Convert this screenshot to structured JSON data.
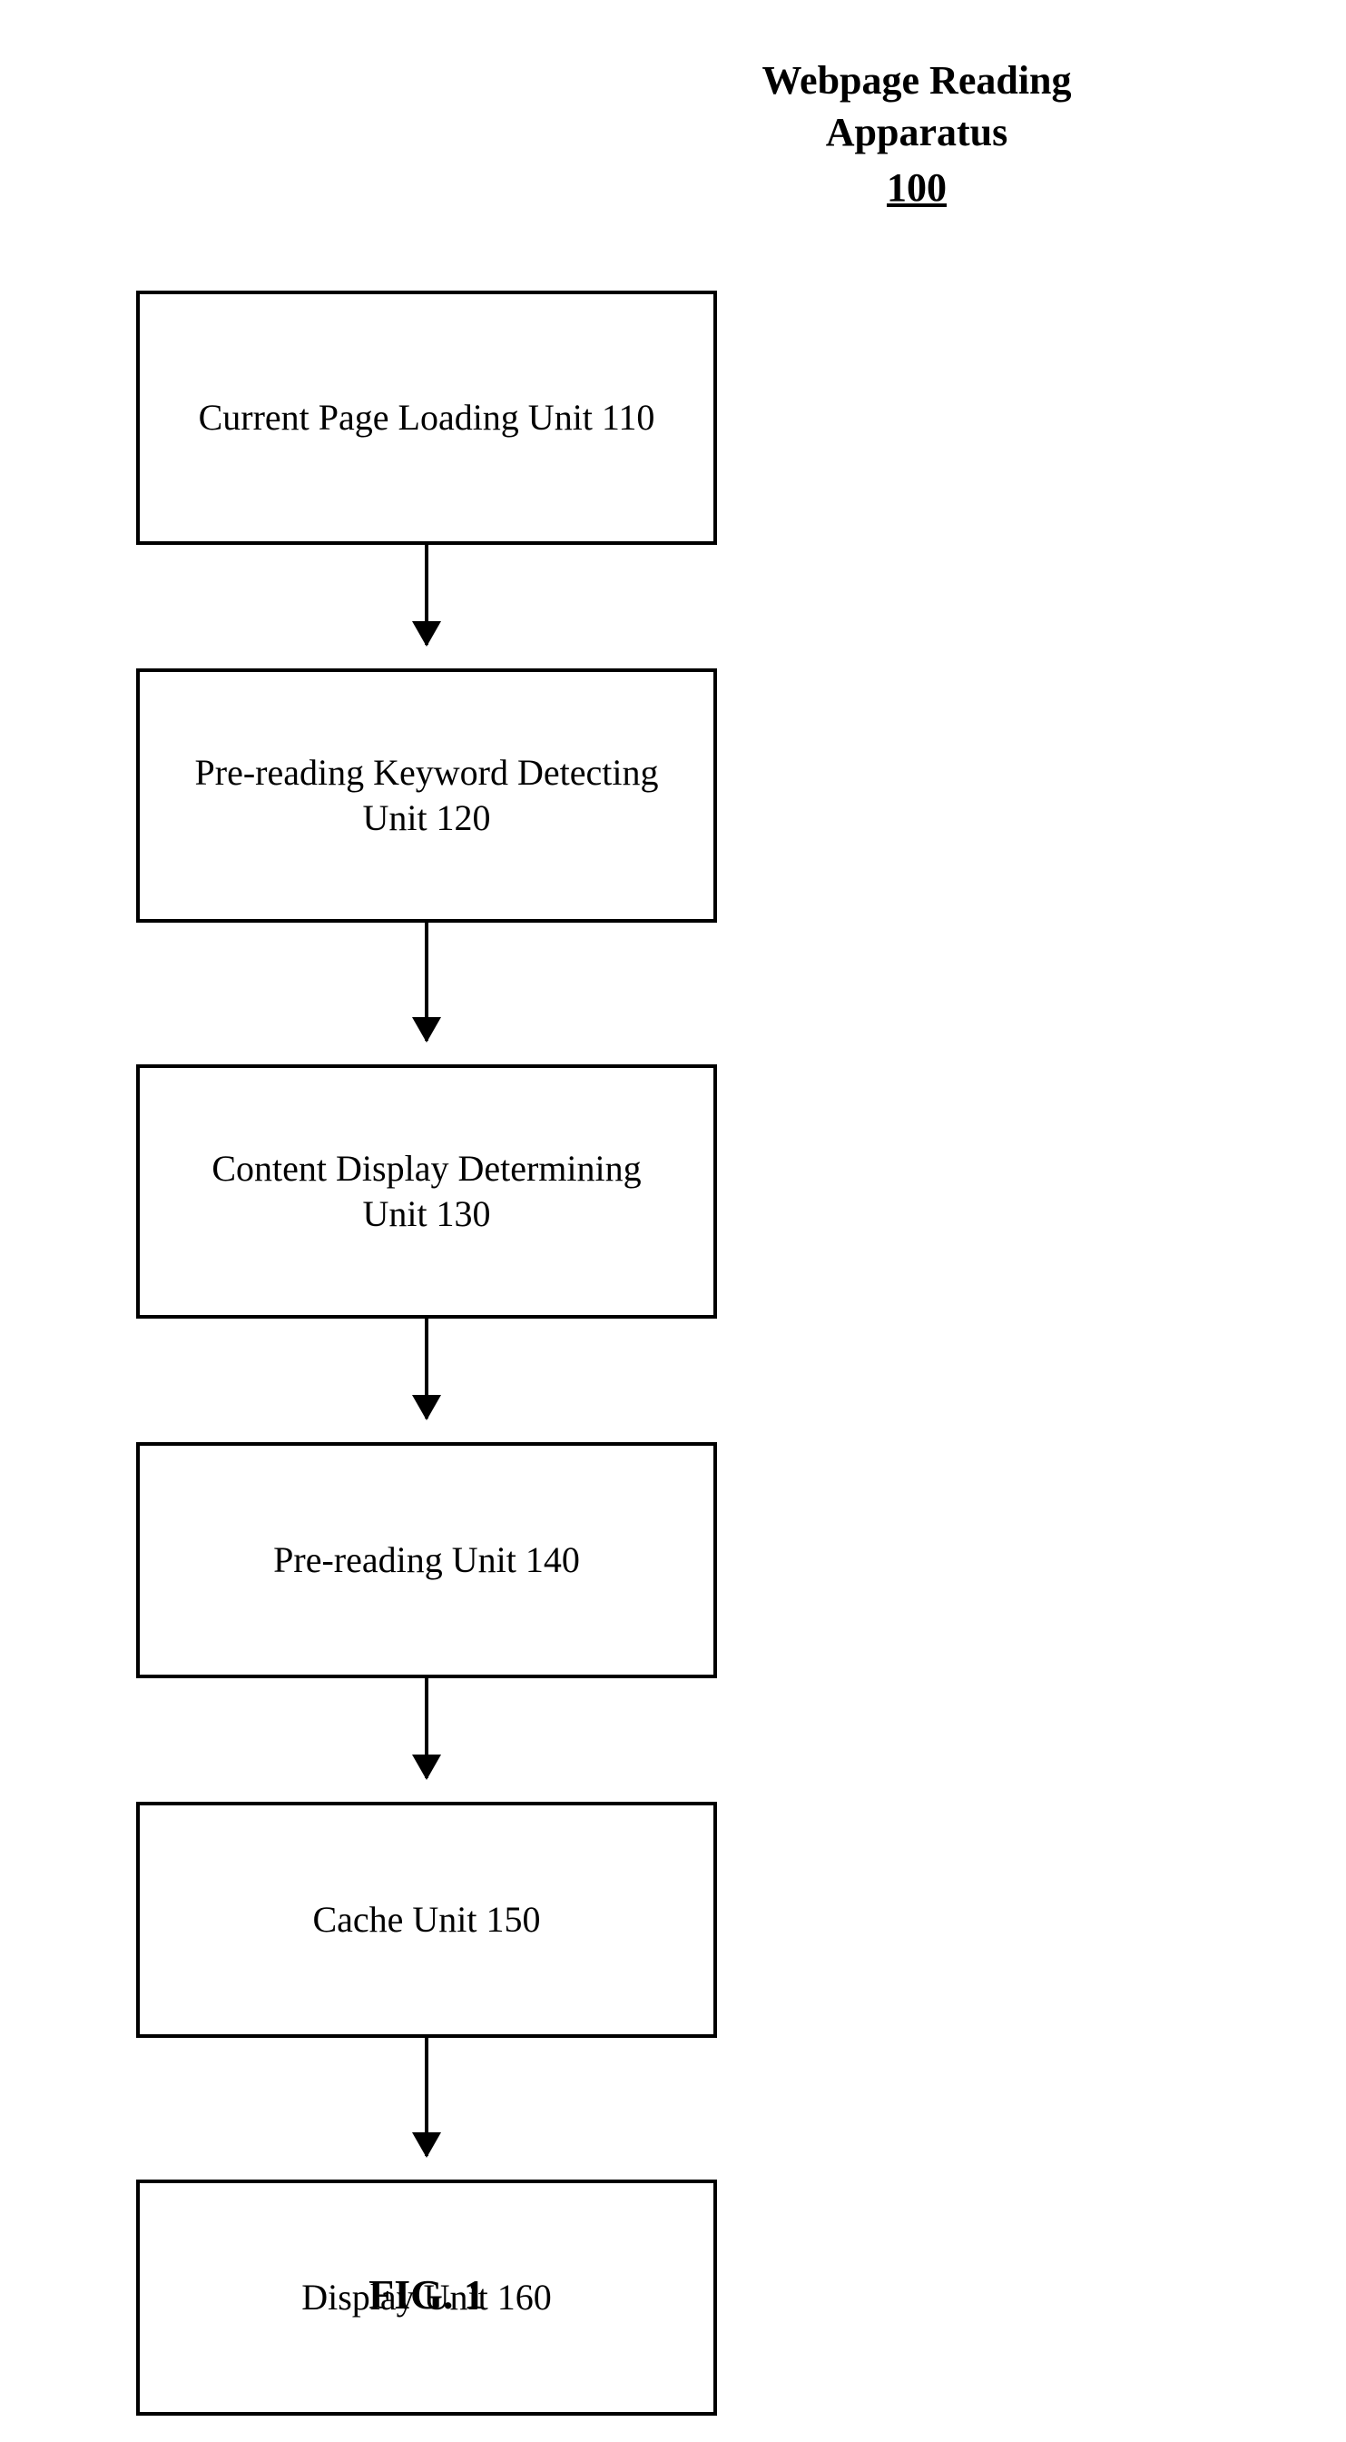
{
  "title": {
    "line1": "Webpage Reading",
    "line2": "Apparatus",
    "number": "100"
  },
  "flow": {
    "boxes": [
      {
        "label": "Current Page Loading Unit 110"
      },
      {
        "label": "Pre-reading Keyword Detecting Unit 120"
      },
      {
        "label": "Content Display Determining Unit 130"
      },
      {
        "label": "Pre-reading Unit 140"
      },
      {
        "label": "Cache Unit 150"
      },
      {
        "label": "Display Unit 160"
      }
    ]
  },
  "figure_caption": "FIG. 1"
}
